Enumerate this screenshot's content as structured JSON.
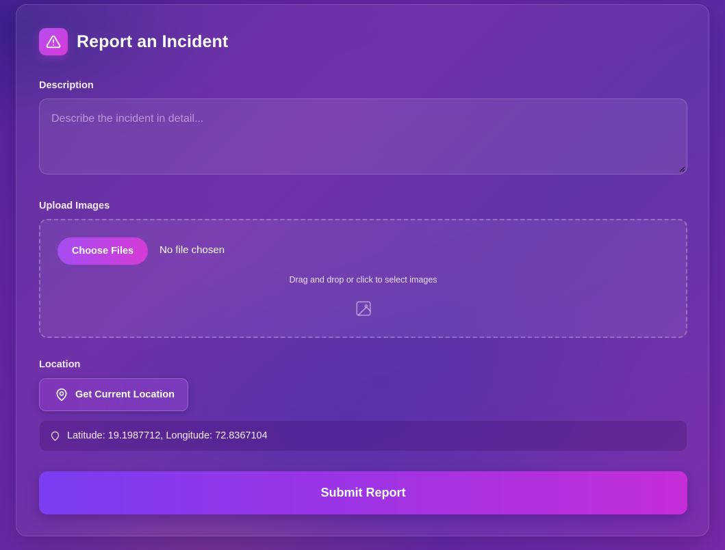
{
  "form": {
    "title": "Report an Incident",
    "header_icon": "warning-triangle-icon",
    "accent_gradient": [
      "#7a3df0",
      "#c42ed8"
    ]
  },
  "description": {
    "label": "Description",
    "placeholder": "Describe the incident in detail...",
    "value": ""
  },
  "upload": {
    "label": "Upload Images",
    "button_label": "Choose Files",
    "status": "No file chosen",
    "hint": "Drag and drop or click to select images",
    "icon": "image-icon"
  },
  "location": {
    "label": "Location",
    "button_label": "Get Current Location",
    "button_icon": "map-pin-icon",
    "coordinates_text": "Latitude: 19.1987712, Longitude: 72.8367104",
    "coordinates_icon": "map-pin-outline-icon"
  },
  "submit": {
    "label": "Submit Report"
  }
}
